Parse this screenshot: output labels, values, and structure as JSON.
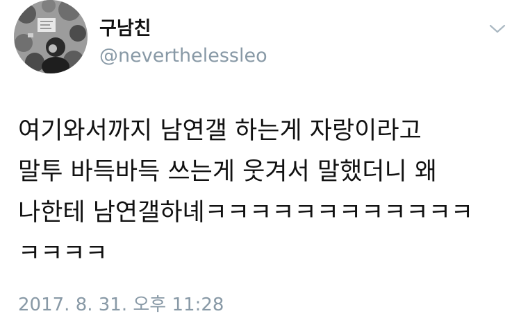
{
  "tweet": {
    "display_name": "구남친",
    "handle": "@neverthelessleo",
    "body_lines": [
      "여기와서까지 남연갤 하는게 자랑이라고",
      "말투 바득바득 쓰는게 웃겨서 말했더니 왜",
      "나한테 남연갤하녜ㅋㅋㅋㅋㅋㅋㅋㅋㅋㅋㅋㅋ",
      "ㅋㅋㅋㅋ"
    ],
    "timestamp": "2017. 8. 31. 오후 11:28"
  },
  "icons": {
    "avatar": "profile-photo",
    "caret": "chevron-down-icon"
  },
  "colors": {
    "text": "#111111",
    "muted": "#8899a6",
    "background": "#ffffff"
  }
}
